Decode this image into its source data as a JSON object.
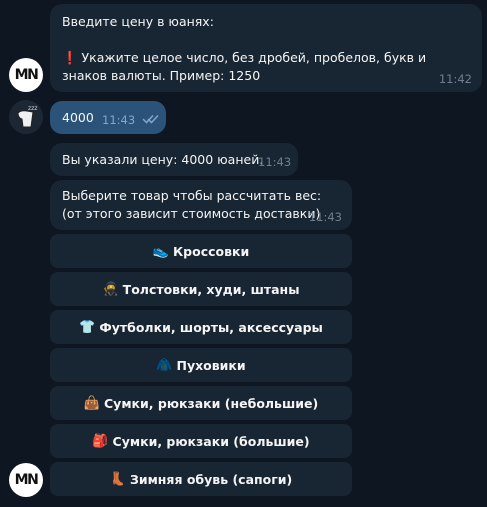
{
  "avatars": {
    "bot_text": "MN",
    "user_icon": "sleeping-avatar-icon"
  },
  "messages": [
    {
      "text": "Введите цену в юанях:\n\n❗ Укажите целое число, без дробей, пробелов, букв и знаков валюты. Пример: 1250",
      "time": "11:42"
    },
    {
      "text": "4000",
      "time": "11:43",
      "status_icon": "double-check-icon"
    },
    {
      "text": "Вы указали цену: 4000 юаней.",
      "time": "11:43"
    },
    {
      "text": "Выберите товар чтобы рассчитать вес:\n(от этого зависит стоимость доставки)",
      "time": "11:43"
    }
  ],
  "keyboard": [
    {
      "emoji": "👟",
      "label": "Кроссовки"
    },
    {
      "emoji": "🥷",
      "label": "Толстовки, худи, штаны"
    },
    {
      "emoji": "👕",
      "label": "Футболки, шорты, аксессуары"
    },
    {
      "emoji": "🧥",
      "label": "Пуховики"
    },
    {
      "emoji": "👜",
      "label": "Сумки, рюкзаки (небольшие)"
    },
    {
      "emoji": "🎒",
      "label": "Сумки, рюкзаки (большие)"
    },
    {
      "emoji": "👢",
      "label": "Зимняя обувь (сапоги)"
    }
  ],
  "colors": {
    "background": "#0e1621",
    "incoming_bubble": "#182533",
    "outgoing_bubble": "#2b5278",
    "time": "#6d7f8f",
    "check": "#7da8d3"
  }
}
